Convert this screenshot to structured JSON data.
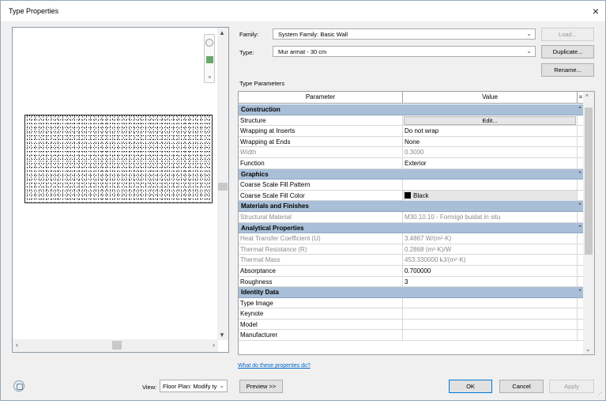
{
  "window": {
    "title": "Type Properties",
    "close_glyph": "×"
  },
  "family": {
    "label": "Family:",
    "value": "System Family: Basic Wall"
  },
  "type": {
    "label": "Type:",
    "value": "Mur armat - 30 cm"
  },
  "buttons": {
    "load": "Load...",
    "duplicate": "Duplicate...",
    "rename": "Rename...",
    "preview": "Preview >>",
    "ok": "OK",
    "cancel": "Cancel",
    "apply": "Apply",
    "edit": "Edit..."
  },
  "type_parameters_label": "Type Parameters",
  "grid": {
    "col_param": "Parameter",
    "col_value": "Value",
    "col_eq": "=",
    "groups": [
      {
        "title": "Construction",
        "rows": [
          {
            "param": "Structure",
            "value": "Edit...",
            "kind": "button"
          },
          {
            "param": "Wrapping at Inserts",
            "value": "Do not wrap"
          },
          {
            "param": "Wrapping at Ends",
            "value": "None"
          },
          {
            "param": "Width",
            "value": "0.3000",
            "dim": true
          },
          {
            "param": "Function",
            "value": "Exterior"
          }
        ]
      },
      {
        "title": "Graphics",
        "rows": [
          {
            "param": "Coarse Scale Fill Pattern",
            "value": ""
          },
          {
            "param": "Coarse Scale Fill Color",
            "value": "Black",
            "kind": "color"
          }
        ]
      },
      {
        "title": "Materials and Finishes",
        "rows": [
          {
            "param": "Structural Material",
            "value": "M30.10.10 - Formigó buidat in situ",
            "dim": true
          }
        ]
      },
      {
        "title": "Analytical Properties",
        "rows": [
          {
            "param": "Heat Transfer Coefficient (U)",
            "value": "3.4867 W/(m²·K)",
            "dim": true
          },
          {
            "param": "Thermal Resistance (R)",
            "value": "0.2868 (m²·K)/W",
            "dim": true
          },
          {
            "param": "Thermal Mass",
            "value": "453.330000 kJ/(m²·K)",
            "dim": true
          },
          {
            "param": "Absorptance",
            "value": "0.700000"
          },
          {
            "param": "Roughness",
            "value": "3"
          }
        ]
      },
      {
        "title": "Identity Data",
        "rows": [
          {
            "param": "Type Image",
            "value": ""
          },
          {
            "param": "Keynote",
            "value": ""
          },
          {
            "param": "Model",
            "value": ""
          },
          {
            "param": "Manufacturer",
            "value": ""
          }
        ]
      }
    ]
  },
  "help_link": "What do these properties do?",
  "view": {
    "label": "View:",
    "value": "Floor Plan: Modify ty"
  },
  "icons": {
    "collapse": "collapse-group-icon",
    "dropdown": "chevron-down-icon",
    "zoom": "zoom-icon",
    "close": "close-icon"
  }
}
